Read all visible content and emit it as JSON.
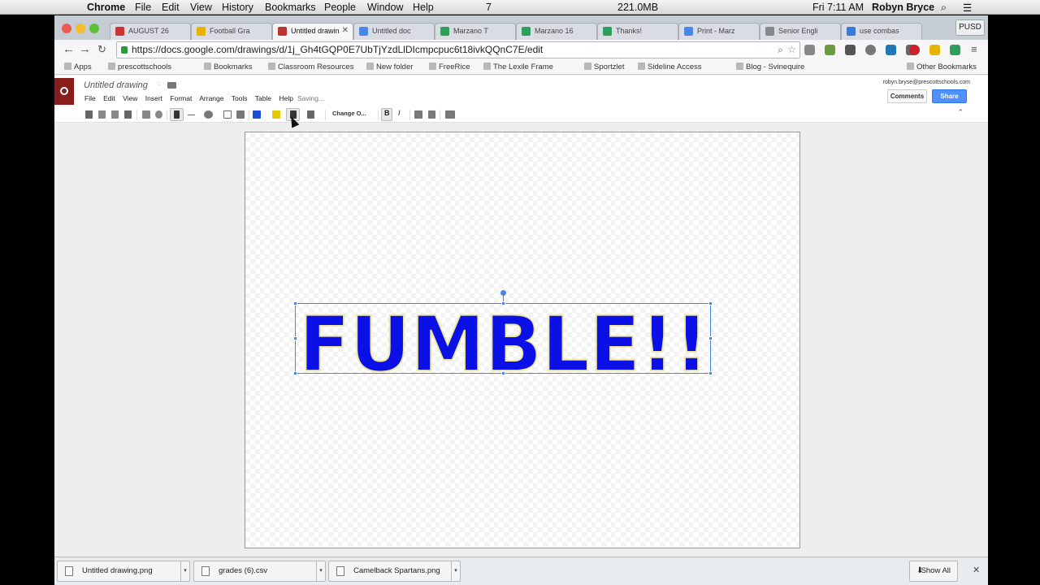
{
  "menubar": {
    "apple": "",
    "app": "Chrome",
    "items": [
      "File",
      "Edit",
      "View",
      "History",
      "Bookmarks",
      "People",
      "Window",
      "Help"
    ],
    "status_count": "7",
    "memory": "221.0MB",
    "clock": "Fri 7:11 AM",
    "user": "Robyn Bryce"
  },
  "tabs": [
    {
      "label": "AUGUST 26",
      "fav": "#c33"
    },
    {
      "label": "Football Gra",
      "fav": "#e8b300"
    },
    {
      "label": "Untitled drawin",
      "fav": "#b33",
      "active": true
    },
    {
      "label": "Untitled doc",
      "fav": "#4a86e8"
    },
    {
      "label": "Marzano T",
      "fav": "#2e9e5b"
    },
    {
      "label": "Marzano 16",
      "fav": "#2e9e5b"
    },
    {
      "label": "Thanks!",
      "fav": "#2e9e5b"
    },
    {
      "label": "Print - Marz",
      "fav": "#4a86e8"
    },
    {
      "label": "Senior Engli",
      "fav": "#888"
    },
    {
      "label": "use combas",
      "fav": "#3a7bd5"
    }
  ],
  "profile_badge": "PUSD",
  "url": "https://docs.google.com/drawings/d/1j_Gh4tGQP0E7UbTjYzdLlDIcmpcpuc6t18ivkQQnC7E/edit",
  "bookmarks": [
    "Apps",
    "prescottschools",
    "Bookmarks",
    "Classroom Resources",
    "New folder",
    "FreeRice",
    "The Lexile Frame",
    "Sportzlet",
    "Sideline Access",
    "Blog - Svinequire",
    "Other Bookmarks"
  ],
  "docs": {
    "title": "Untitled drawing",
    "menu": [
      "File",
      "Edit",
      "View",
      "Insert",
      "Format",
      "Arrange",
      "Tools",
      "Table",
      "Help"
    ],
    "saving": "Saving...",
    "account": "robyn.bryse@prescottschools.com",
    "comments_label": "Comments",
    "share_label": "Share",
    "font_dropdown": "Change O..."
  },
  "canvas": {
    "wordart_text": "FUMBLE!!",
    "wordart_fill": "#0a10e6",
    "wordart_stroke": "#f0e8a0"
  },
  "downloads": [
    {
      "label": "Untitled drawing.png"
    },
    {
      "label": "grades (6).csv"
    },
    {
      "label": "Camelback Spartans.png"
    }
  ],
  "show_all_label": "Show All"
}
